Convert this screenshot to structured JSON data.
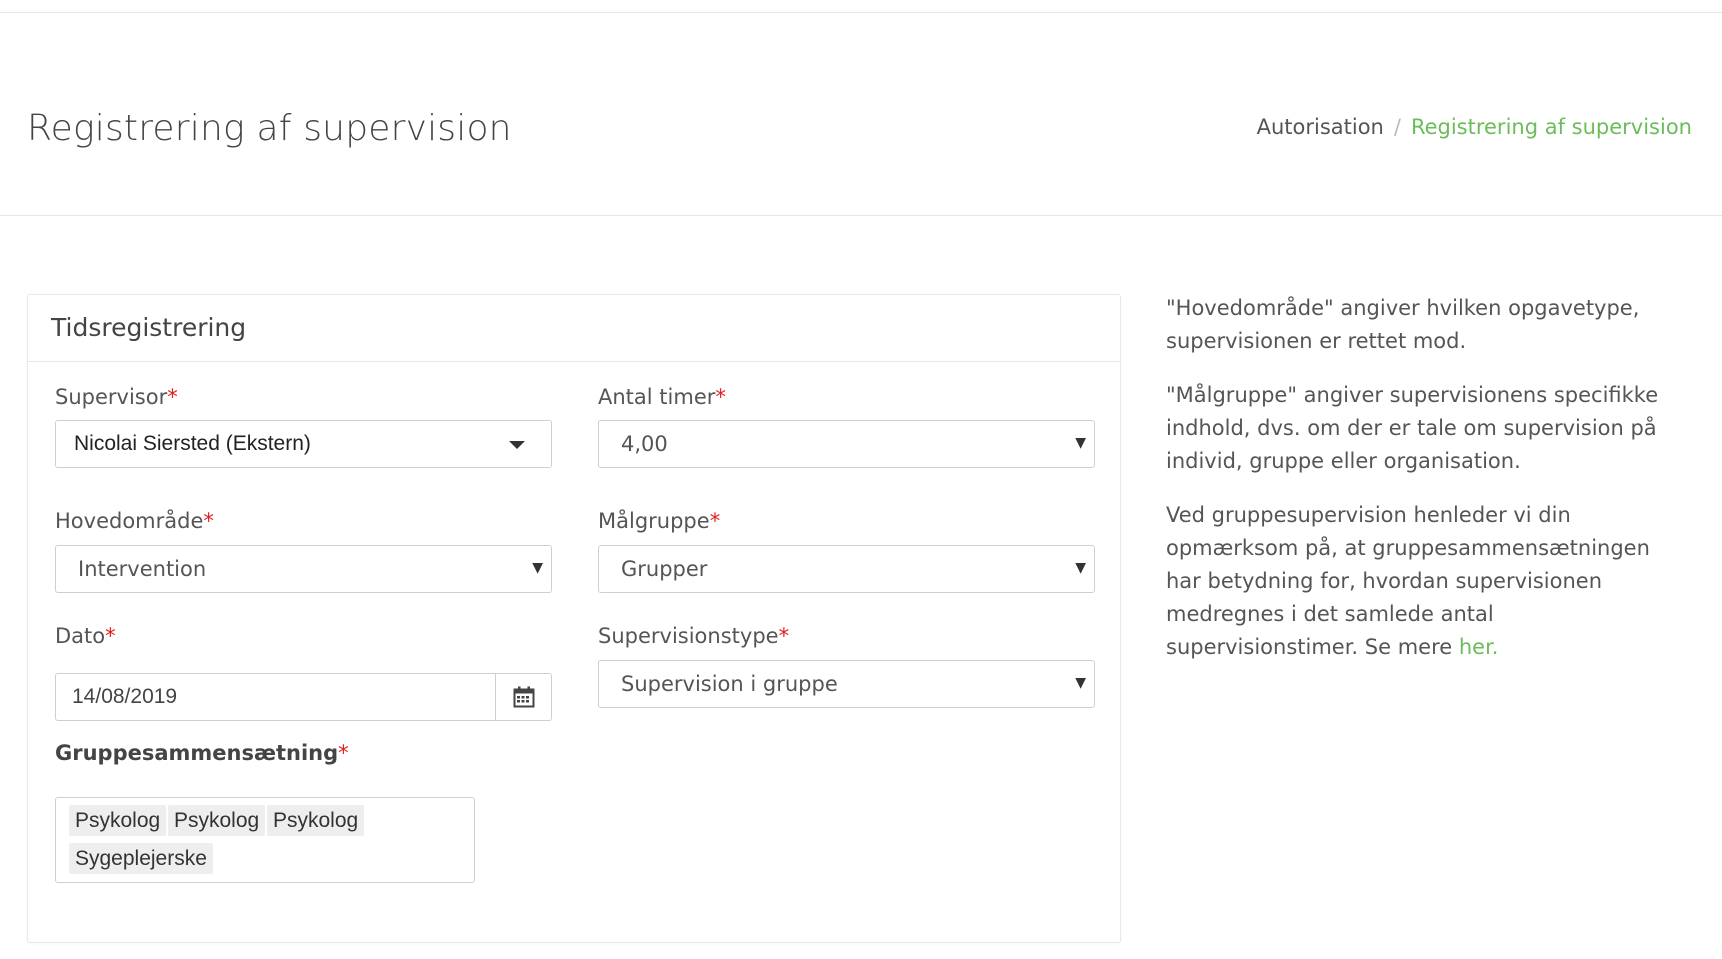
{
  "header": {
    "title": "Registrering af supervision",
    "breadcrumb": {
      "home": "Autorisation",
      "separator": "/",
      "current": "Registrering af supervision"
    }
  },
  "panel": {
    "title": "Tidsregistrering",
    "required_marker": "*",
    "fields": {
      "supervisor": {
        "label": "Supervisor",
        "value": "Nicolai Siersted (Ekstern)"
      },
      "antal_timer": {
        "label": "Antal timer",
        "value": "4,00"
      },
      "hovedomraade": {
        "label": "Hovedområde",
        "value": "Intervention"
      },
      "maalgruppe": {
        "label": "Målgruppe",
        "value": "Grupper"
      },
      "dato": {
        "label": "Dato",
        "value": "14/08/2019"
      },
      "supervisionstype": {
        "label": "Supervisionstype",
        "value": "Supervision i gruppe"
      },
      "gruppesammensaetning": {
        "label": "Gruppesammensætning",
        "tags": [
          "Psykolog",
          "Psykolog",
          "Psykolog",
          "Sygeplejerske"
        ]
      }
    }
  },
  "info": {
    "p1": "\"Hovedområde\" angiver hvilken opgavetype, supervisionen er rettet mod.",
    "p2": "\"Målgruppe\" angiver supervisionens specifikke indhold, dvs. om der er tale om supervision på individ, gruppe eller organisation.",
    "p3": "Ved gruppesupervision henleder vi din opmærksom på, at gruppesammensætningen har betydning for, hvordan supervisionen medregnes i det samlede antal supervisionstimer. Se mere",
    "p3_link": "her."
  },
  "colors": {
    "accent": "#6cbd5a",
    "required": "#e02020",
    "border": "#cfcfcf"
  },
  "icons": {
    "calendar": "calendar-icon",
    "select_caret": "caret-down-icon"
  }
}
